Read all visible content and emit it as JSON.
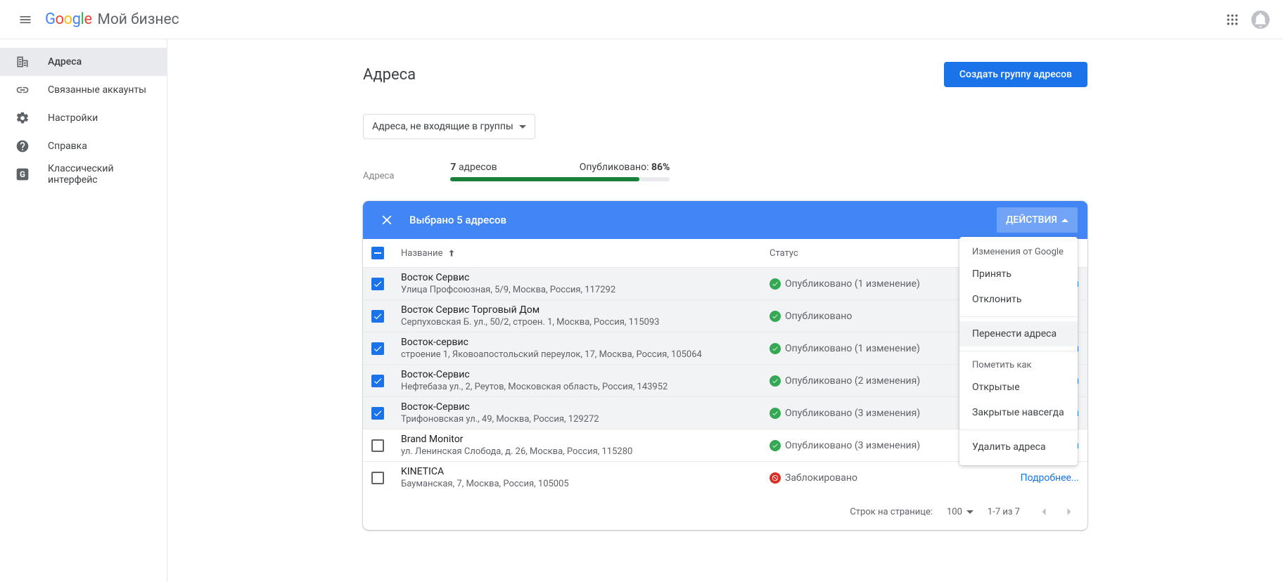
{
  "header": {
    "product": "Мой бизнес"
  },
  "sidebar": {
    "items": [
      {
        "label": "Адреса"
      },
      {
        "label": "Связанные аккаунты"
      },
      {
        "label": "Настройки"
      },
      {
        "label": "Справка"
      },
      {
        "label": "Классический интерфейс"
      }
    ]
  },
  "panel": {
    "title": "Адреса",
    "create_btn": "Создать группу адресов",
    "filter": "Адреса, не входящие в группы",
    "stats": {
      "label": "Адреса",
      "count": "7",
      "count_suffix": "адресов",
      "published_prefix": "Опубликовано:",
      "published_pct": "86%",
      "bar_pct": 86
    }
  },
  "selbar": {
    "label": "Выбрано 5 адресов",
    "actions": "ДЕЙСТВИЯ"
  },
  "colhead": {
    "name": "Название",
    "status": "Статус"
  },
  "rows": [
    {
      "selected": true,
      "name": "Восток Сервис",
      "addr": "Улица Профсоюзная, 5/9, Москва, Россия, 117292",
      "status": "Опубликовано (1 изменение)",
      "kind": "pub",
      "link": "Посмотреть изменения"
    },
    {
      "selected": true,
      "name": "Восток Сервис Торговый Дом",
      "addr": "Серпуховская Б. ул., 50/2, строен. 1, Москва, Россия, 115093",
      "status": "Опубликовано",
      "kind": "pub",
      "link": ""
    },
    {
      "selected": true,
      "name": "Восток-сервис",
      "addr": "строение 1, Яковоапостольский переулок, 17, Москва, Россия, 105064",
      "status": "Опубликовано (1 изменение)",
      "kind": "pub",
      "link": "Посмотреть изменения"
    },
    {
      "selected": true,
      "name": "Восток-Сервис",
      "addr": "Нефтебаза ул., 2, Реутов, Московская область, Россия, 143952",
      "status": "Опубликовано (2 изменения)",
      "kind": "pub",
      "link": "Посмотреть изменения"
    },
    {
      "selected": true,
      "name": "Восток-Сервис",
      "addr": "Трифоновская ул., 49, Москва, Россия, 129272",
      "status": "Опубликовано (3 изменения)",
      "kind": "pub",
      "link": "Посмотреть изменения"
    },
    {
      "selected": false,
      "name": "Brand Monitor",
      "addr": "ул. Ленинская Слобода, д. 26, Москва, Россия, 115280",
      "status": "Опубликовано (3 изменения)",
      "kind": "pub",
      "link": "Посмотреть изменения"
    },
    {
      "selected": false,
      "name": "KINETICA",
      "addr": "Бауманская, 7, Москва, Россия, 105005",
      "status": "Заблокировано",
      "kind": "block",
      "link": "Подробнее..."
    }
  ],
  "menu": {
    "section1": "Изменения от Google",
    "accept": "Принять",
    "reject": "Отклонить",
    "move": "Перенести адреса",
    "section2": "Пометить как",
    "open": "Открытые",
    "closed": "Закрытые навсегда",
    "delete": "Удалить адреса"
  },
  "pager": {
    "rows_label": "Строк на странице:",
    "rows_value": "100",
    "range": "1-7 из 7"
  }
}
